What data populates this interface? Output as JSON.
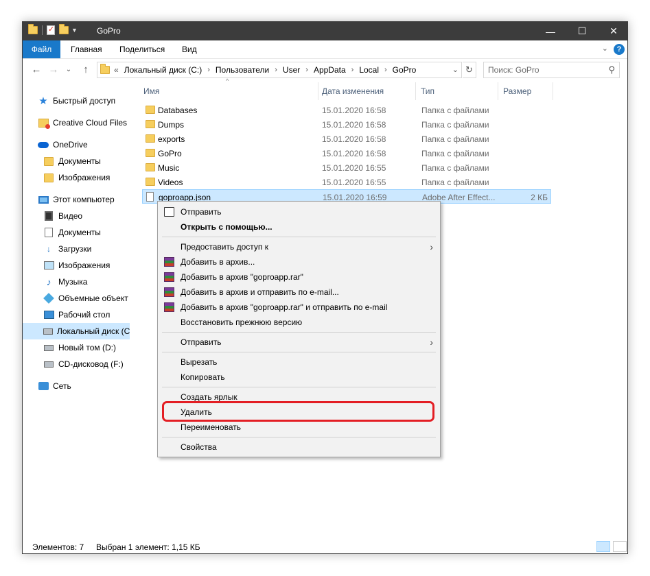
{
  "window": {
    "title": "GoPro",
    "minimize_icon": "minimize-icon",
    "maximize_icon": "maximize-icon",
    "close_icon": "close-icon",
    "minimize": "—",
    "maximize": "☐",
    "close": "✕"
  },
  "ribbon": {
    "tabs": [
      "Файл",
      "Главная",
      "Поделиться",
      "Вид"
    ],
    "expand": "⌄",
    "help": "?"
  },
  "nav": {
    "back": "←",
    "forward": "→",
    "recent": "⌄",
    "up": "↑",
    "breadcrumb_overflow": "«",
    "breadcrumbs": [
      "Локальный диск (C:)",
      "Пользователи",
      "User",
      "AppData",
      "Local",
      "GoPro"
    ],
    "crumb_separator": "›",
    "dropdown": "⌄",
    "refresh": "↻",
    "search_placeholder": "Поиск: GoPro",
    "search_icon": "⚲"
  },
  "sidebar": {
    "items": [
      {
        "label": "Быстрый доступ",
        "icon": "star-icon"
      },
      {
        "label": "Creative Cloud Files",
        "icon": "creative-cloud-folder-icon"
      },
      {
        "label": "OneDrive",
        "icon": "onedrive-icon"
      },
      {
        "label": "Документы",
        "icon": "folder-icon"
      },
      {
        "label": "Изображения",
        "icon": "folder-icon"
      },
      {
        "label": "Этот компьютер",
        "icon": "computer-icon"
      },
      {
        "label": "Видео",
        "icon": "video-icon"
      },
      {
        "label": "Документы",
        "icon": "documents-icon"
      },
      {
        "label": "Загрузки",
        "icon": "downloads-icon"
      },
      {
        "label": "Изображения",
        "icon": "pictures-icon"
      },
      {
        "label": "Музыка",
        "icon": "music-icon"
      },
      {
        "label": "Объемные объект",
        "icon": "3d-objects-icon"
      },
      {
        "label": "Рабочий стол",
        "icon": "desktop-icon"
      },
      {
        "label": "Локальный диск (C",
        "icon": "drive-icon"
      },
      {
        "label": "Новый том (D:)",
        "icon": "drive-icon"
      },
      {
        "label": "CD-дисковод (F:)",
        "icon": "cd-drive-icon"
      },
      {
        "label": "Сеть",
        "icon": "network-icon"
      }
    ]
  },
  "columns": {
    "name": "Имя",
    "date": "Дата изменения",
    "type": "Тип",
    "size": "Размер",
    "sort_indicator": "^"
  },
  "files": [
    {
      "name": "Databases",
      "date": "15.01.2020 16:58",
      "type": "Папка с файлами",
      "size": ""
    },
    {
      "name": "Dumps",
      "date": "15.01.2020 16:58",
      "type": "Папка с файлами",
      "size": ""
    },
    {
      "name": "exports",
      "date": "15.01.2020 16:58",
      "type": "Папка с файлами",
      "size": ""
    },
    {
      "name": "GoPro",
      "date": "15.01.2020 16:58",
      "type": "Папка с файлами",
      "size": ""
    },
    {
      "name": "Music",
      "date": "15.01.2020 16:55",
      "type": "Папка с файлами",
      "size": ""
    },
    {
      "name": "Videos",
      "date": "15.01.2020 16:55",
      "type": "Папка с файлами",
      "size": ""
    },
    {
      "name": "goproapp.json",
      "date": "15.01.2020 16:59",
      "type": "Adobe After Effect...",
      "size": "2 КБ"
    }
  ],
  "context_menu": {
    "send": "Отправить",
    "open_with": "Открыть с помощью...",
    "give_access": "Предоставить доступ к",
    "add_archive": "Добавить в архив...",
    "add_archive_rar": "Добавить в архив \"goproapp.rar\"",
    "add_archive_email": "Добавить в архив и отправить по e-mail...",
    "add_archive_rar_email": "Добавить в архив \"goproapp.rar\" и отправить по e-mail",
    "restore": "Восстановить прежнюю версию",
    "send_to": "Отправить",
    "cut": "Вырезать",
    "copy": "Копировать",
    "create_shortcut": "Создать ярлык",
    "delete": "Удалить",
    "rename": "Переименовать",
    "properties": "Свойства",
    "submenu_arrow": "›"
  },
  "status": {
    "count": "Элементов: 7",
    "selected": "Выбран 1 элемент: 1,15 КБ"
  },
  "colors": {
    "accent": "#1979ca",
    "selection": "#cce8ff",
    "highlight_ring": "#e31e24"
  }
}
